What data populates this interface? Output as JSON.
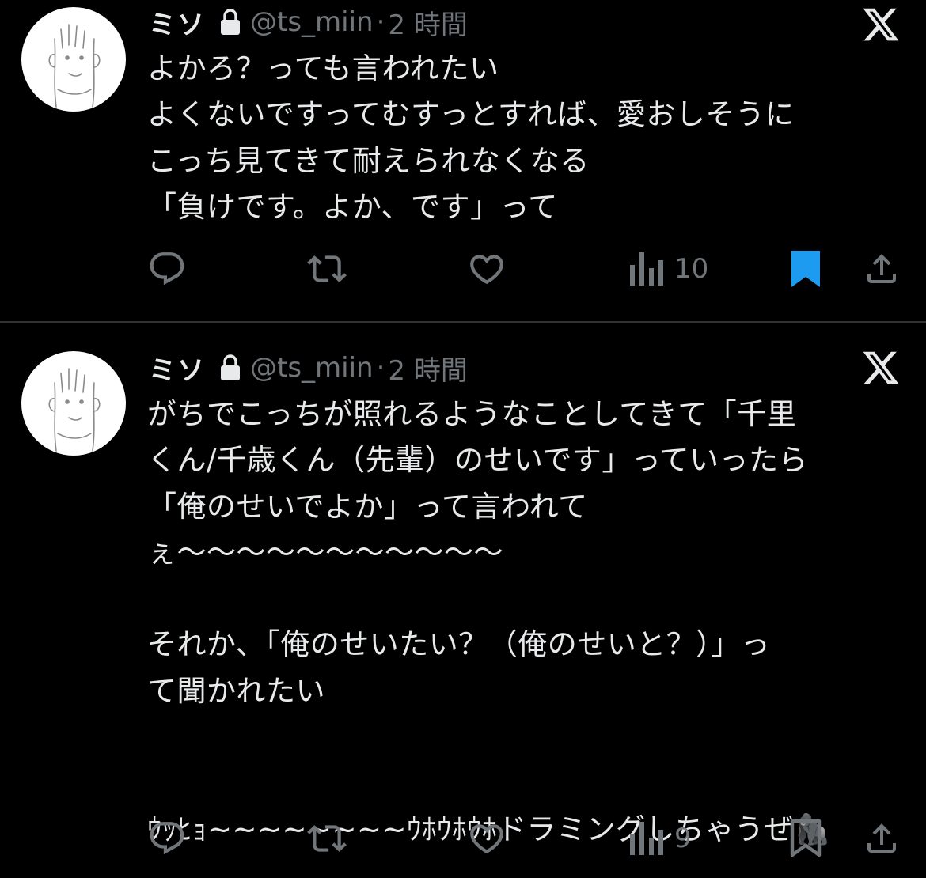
{
  "tweets": [
    {
      "name": "ミソ",
      "handle": "@ts_miin",
      "separator": "·",
      "time": "2 時間",
      "lines": [
        "よかろ？っても言われたい",
        "よくないですってむすっとすれば、愛おしそうに",
        "こっち見てきて耐えられなくなる",
        "「負けです。よか、です」って"
      ],
      "views": "10",
      "bookmarked": true
    },
    {
      "name": "ミソ",
      "handle": "@ts_miin",
      "separator": "·",
      "time": "2 時間",
      "lines": [
        "がちでこっちが照れるようなことしてきて「千里",
        "くん/千歳くん（先輩）のせいです」っていったら",
        "「俺のせいでよか」って言われて",
        "ぇ〜〜〜〜〜〜〜〜〜〜〜",
        "",
        "それか、「俺のせいたい？（俺のせいと？）」っ",
        "て聞かれたい",
        "",
        "",
        "ｳｯﾋｮ~~~~~~~~ｳﾎｳﾎｳﾎドラミングしちゃうぜ🦍"
      ],
      "views": "9",
      "bookmarked": false
    }
  ],
  "colors": {
    "background": "#000000",
    "text": "#e7e9ea",
    "secondary": "#71767b",
    "divider": "#2f3336",
    "bookmark_active": "#1d9bf0"
  },
  "icons": [
    "lock-icon",
    "x-logo-icon",
    "reply-icon",
    "retweet-icon",
    "like-icon",
    "views-icon",
    "bookmark-icon",
    "share-icon"
  ]
}
